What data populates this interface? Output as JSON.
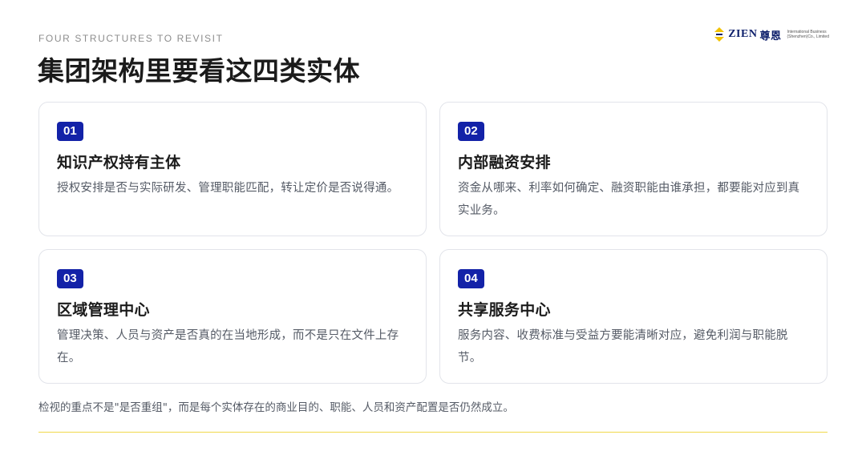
{
  "header": {
    "eyebrow": "FOUR STRUCTURES TO REVISIT",
    "title": "集团架构里要看这四类实体"
  },
  "logo": {
    "brand_latin": "ZIEN",
    "brand_cn": "尊恩",
    "sub_line1": "International Business",
    "sub_line2": "(Shenzhen)Co., Limited",
    "accent_color": "#f2c200",
    "brand_color": "#0d1f6b"
  },
  "cards": [
    {
      "number": "01",
      "title": "知识产权持有主体",
      "body": "授权安排是否与实际研发、管理职能匹配，转让定价是否说得通。"
    },
    {
      "number": "02",
      "title": "内部融资安排",
      "body": "资金从哪来、利率如何确定、融资职能由谁承担，都要能对应到真实业务。"
    },
    {
      "number": "03",
      "title": "区域管理中心",
      "body": "管理决策、人员与资产是否真的在当地形成，而不是只在文件上存在。"
    },
    {
      "number": "04",
      "title": "共享服务中心",
      "body": "服务内容、收费标准与受益方要能清晰对应，避免利润与职能脱节。"
    }
  ],
  "footer": {
    "note": "检视的重点不是\"是否重组\"，而是每个实体存在的商业目的、职能、人员和资产配置是否仍然成立。"
  },
  "colors": {
    "badge": "#1322a8",
    "divider": "#f0d84a"
  }
}
